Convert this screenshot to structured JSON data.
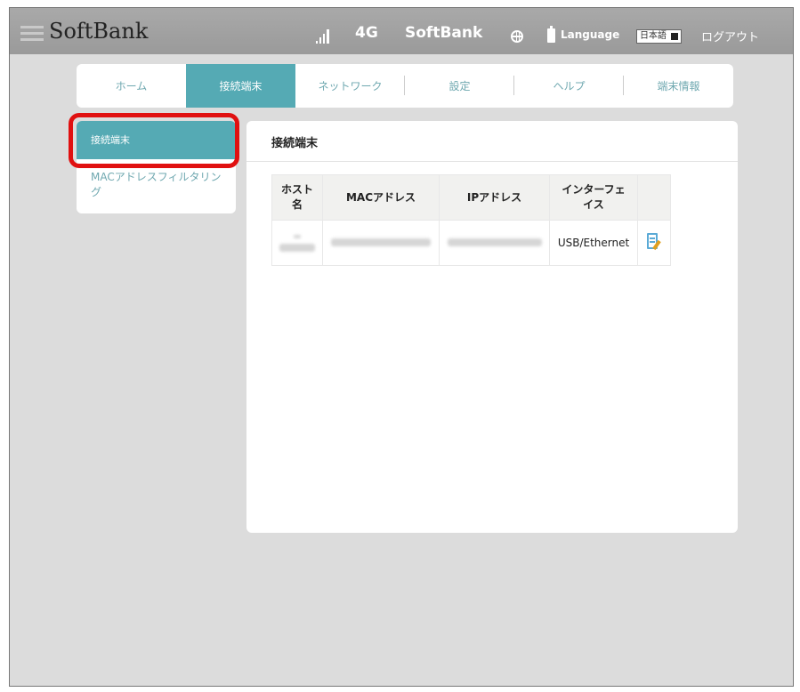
{
  "header": {
    "brand": "SoftBank",
    "network_type": "4G",
    "carrier": "SoftBank",
    "language_label": "Language",
    "language_value": "日本語",
    "logout": "ログアウト"
  },
  "tabs": [
    {
      "label": "ホーム"
    },
    {
      "label": "接続端末"
    },
    {
      "label": "ネットワーク"
    },
    {
      "label": "設定"
    },
    {
      "label": "ヘルプ"
    },
    {
      "label": "端末情報"
    }
  ],
  "sidebar": {
    "items": [
      {
        "label": "接続端末"
      },
      {
        "label": "MACアドレスフィルタリング"
      }
    ]
  },
  "main": {
    "title": "接続端末",
    "table": {
      "headers": [
        "ホスト名",
        "MACアドレス",
        "IPアドレス",
        "インターフェイス"
      ],
      "rows": [
        {
          "host": "",
          "mac": "",
          "ip": "",
          "interface": "USB/Ethernet"
        }
      ]
    }
  },
  "colors": {
    "accent": "#55aab4",
    "highlight": "#e01010",
    "topbar": "#9f9f9f",
    "background": "#dcdcdc"
  },
  "icons": [
    "menu-icon",
    "signal-icon",
    "globe-icon",
    "battery-icon",
    "edit-icon"
  ]
}
